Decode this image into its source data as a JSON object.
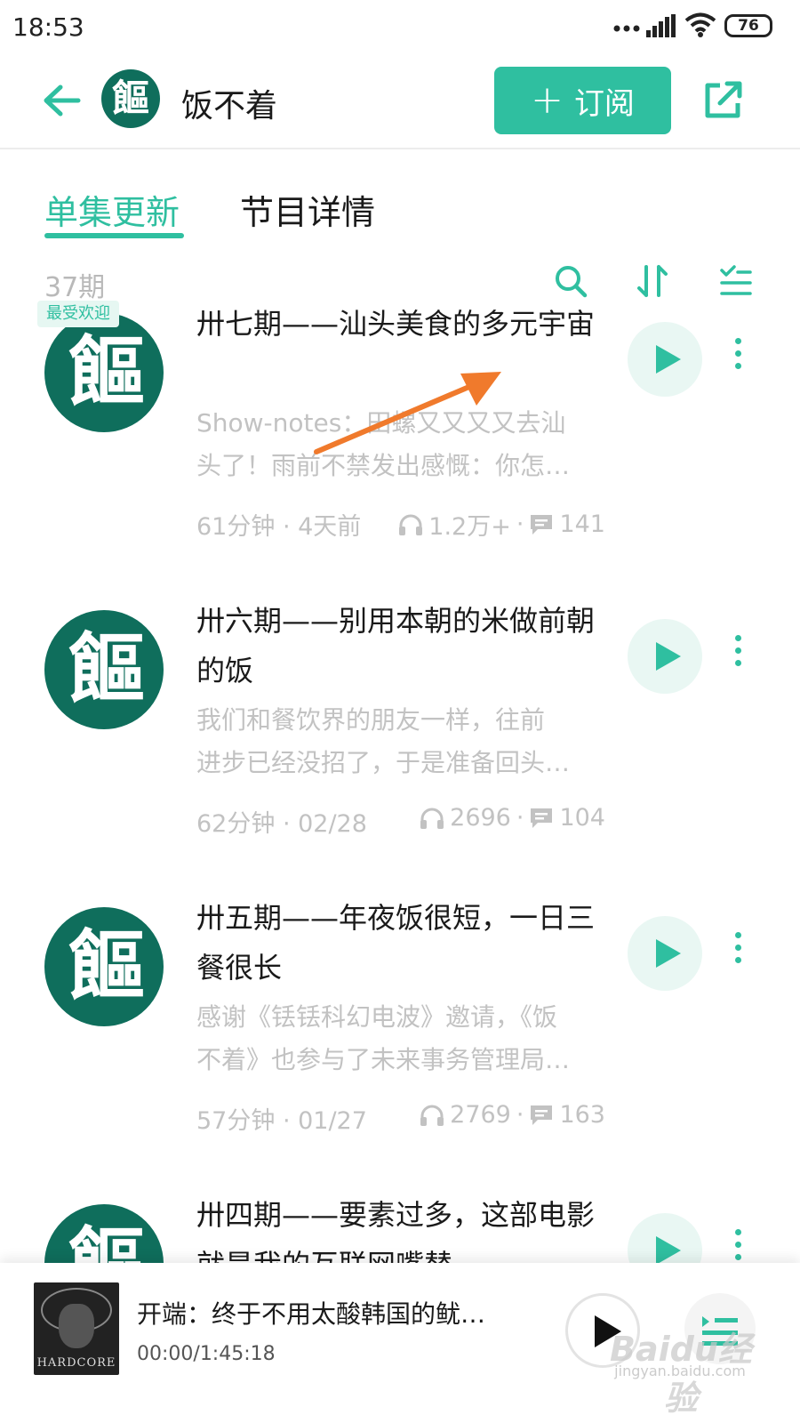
{
  "status_bar": {
    "time": "18:53",
    "battery": "76"
  },
  "header": {
    "channel_title": "饭不着",
    "channel_logo_text": "饇",
    "subscribe_label": "订阅"
  },
  "tabs": [
    {
      "label": "单集更新",
      "active": true
    },
    {
      "label": "节目详情",
      "active": false
    }
  ],
  "toolbar": {
    "episode_count": "37期"
  },
  "episodes": [
    {
      "badge": "最受欢迎",
      "title": "卅七期——汕头美食的多元宇宙",
      "desc_line1": "Show-notes：田螺又又又又去汕",
      "desc_line2": "头了！雨前不禁发出感慨：你怎…",
      "duration_date": "61分钟 · 4天前",
      "plays": "1.2万+",
      "comments": "141"
    },
    {
      "badge": "",
      "title": "卅六期——别用本朝的米做前朝的饭",
      "desc_line1": "我们和餐饮界的朋友一样，往前",
      "desc_line2": "进步已经没招了，于是准备回头…",
      "duration_date": "62分钟 · 02/28",
      "plays": "2696",
      "comments": "104"
    },
    {
      "badge": "",
      "title": "卅五期——年夜饭很短，一日三餐很长",
      "desc_line1": "感谢《铥铥科幻电波》邀请，《饭",
      "desc_line2": "不着》也参与了未来事务管理局…",
      "duration_date": "57分钟 · 01/27",
      "plays": "2769",
      "comments": "163"
    },
    {
      "badge": "",
      "title": "卅四期——要素过多，这部电影就是我的互联网嘴替",
      "desc_line1": "",
      "desc_line2": "",
      "duration_date": "",
      "plays": "",
      "comments": ""
    }
  ],
  "player": {
    "title": "开端：终于不用太酸韩国的鱿…",
    "time": "00:00/1:45:18",
    "cover_text": "HARDCORE"
  },
  "watermark": {
    "main": "Baidu经验",
    "sub": "jingyan.baidu.com"
  },
  "colors": {
    "accent": "#2fbfa0",
    "cover_bg": "#0f6e5c",
    "muted_text": "#c2c2c2",
    "annotation_arrow": "#f07a2c"
  },
  "icons": {
    "back": "arrow-left-icon",
    "share": "share-external-icon",
    "search": "search-icon",
    "sort": "sort-icon",
    "filter": "list-filter-icon",
    "play": "play-icon",
    "more": "more-vertical-icon",
    "headphones": "headphones-icon",
    "comment": "comment-icon",
    "playlist": "playlist-icon"
  }
}
